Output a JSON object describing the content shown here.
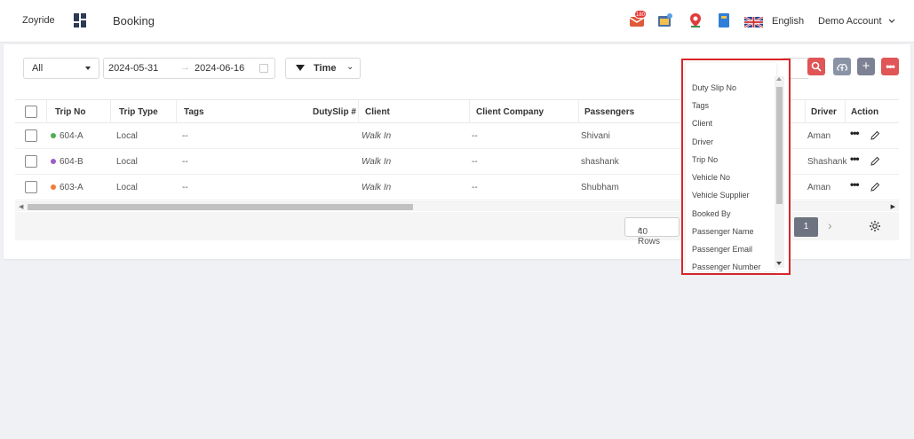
{
  "header": {
    "brand": "Zoyride",
    "title": "Booking",
    "notification_count": "180",
    "language": "English",
    "account": "Demo Account"
  },
  "filters": {
    "status": "All",
    "date_from": "2024-05-31",
    "date_to": "2024-06-16",
    "time_label": "Time"
  },
  "table": {
    "columns": [
      "Trip No",
      "Trip Type",
      "Tags",
      "DutySlip #",
      "Client",
      "Client Company",
      "Passengers",
      "Driver",
      "Action"
    ],
    "rows": [
      {
        "trip_no": "604-A",
        "dot_color": "#4caf50",
        "trip_type": "Local",
        "tags": "--",
        "client": "Walk In",
        "client_company": "--",
        "passengers": "Shivani",
        "driver": "Aman"
      },
      {
        "trip_no": "604-B",
        "dot_color": "#9c5fc7",
        "trip_type": "Local",
        "tags": "--",
        "client": "Walk In",
        "client_company": "--",
        "passengers": "shashank",
        "driver": "Shashank"
      },
      {
        "trip_no": "603-A",
        "dot_color": "#f07c3a",
        "trip_type": "Local",
        "tags": "--",
        "client": "Walk In",
        "client_company": "--",
        "passengers": "Shubham",
        "driver": "Aman"
      }
    ]
  },
  "pagination": {
    "rows_label": "40 Rows",
    "current_page": "1"
  },
  "column_dropdown": {
    "options": [
      "Duty Slip No",
      "Tags",
      "Client",
      "Driver",
      "Trip No",
      "Vehicle No",
      "Vehicle Supplier",
      "Booked By",
      "Passenger Name",
      "Passenger Email",
      "Passenger Number"
    ]
  },
  "colors": {
    "search_button": "#e05555",
    "upload_button": "#8a93a6",
    "add_button": "#7c8294",
    "more_button": "#e05555",
    "dropdown_border": "#d9262b"
  }
}
